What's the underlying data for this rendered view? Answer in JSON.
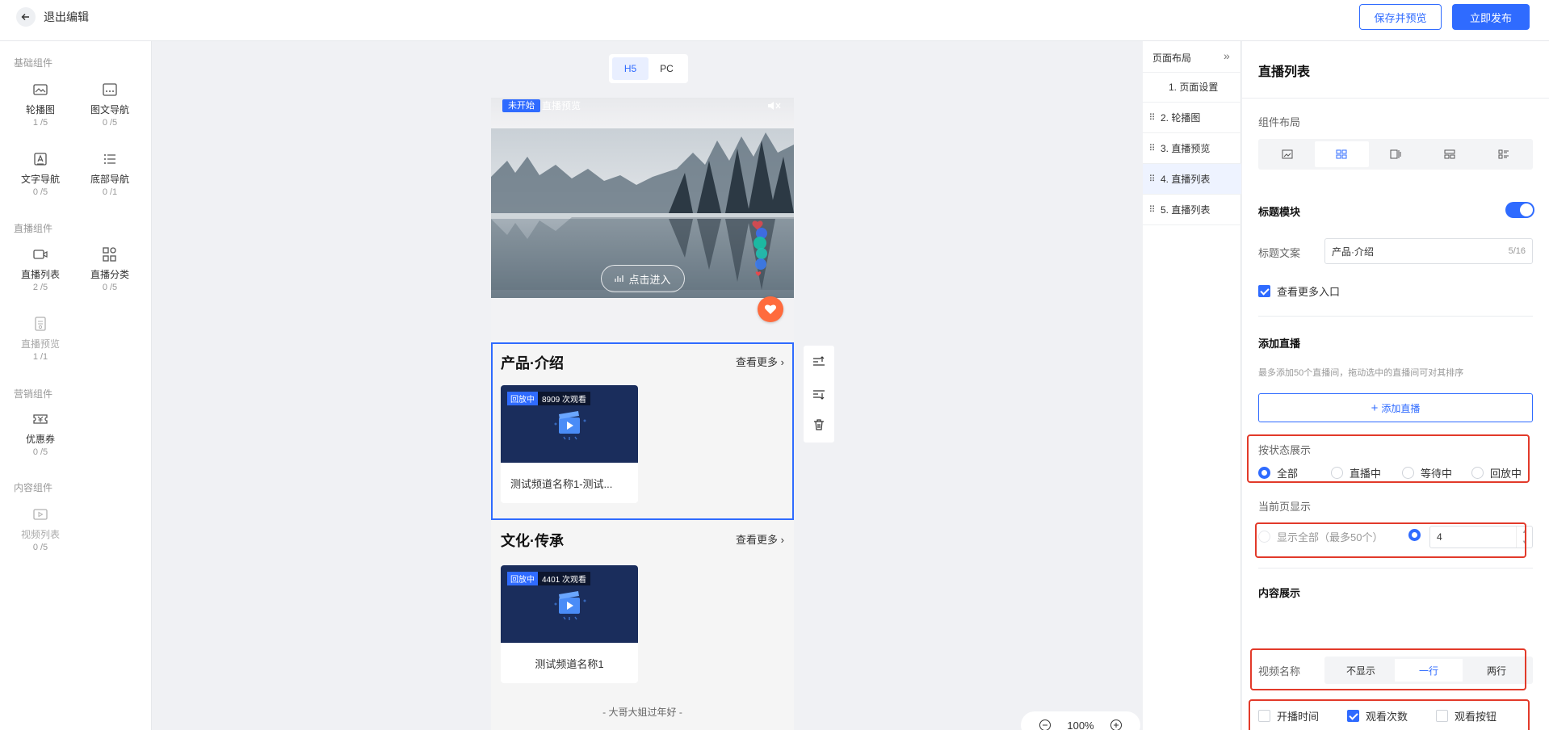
{
  "topbar": {
    "back_label": "退出编辑",
    "save_preview_label": "保存并预览",
    "publish_label": "立即发布"
  },
  "components": {
    "groups": [
      {
        "title": "基础组件",
        "items": [
          {
            "name": "轮播图",
            "count": "1 /5",
            "icon": "image-icon"
          },
          {
            "name": "图文导航",
            "count": "0 /5",
            "icon": "grid-nav-icon"
          },
          {
            "name": "文字导航",
            "count": "0 /5",
            "icon": "text-nav-icon"
          },
          {
            "name": "底部导航",
            "count": "0 /1",
            "icon": "list-icon"
          }
        ]
      },
      {
        "title": "直播组件",
        "items": [
          {
            "name": "直播列表",
            "count": "2 /5",
            "icon": "video-camera-icon"
          },
          {
            "name": "直播分类",
            "count": "0 /5",
            "icon": "category-icon"
          },
          {
            "name": "直播预览",
            "count": "1 /1",
            "icon": "preview-doc-icon"
          }
        ]
      },
      {
        "title": "营销组件",
        "items": [
          {
            "name": "优惠券",
            "count": "0 /5",
            "icon": "coupon-icon"
          }
        ]
      },
      {
        "title": "内容组件",
        "items": [
          {
            "name": "视频列表",
            "count": "0 /5",
            "icon": "video-list-icon"
          }
        ]
      }
    ]
  },
  "canvas": {
    "device_tabs": [
      "H5",
      "PC"
    ],
    "hero": {
      "status": "未开始",
      "title": "直播预览",
      "enter_label": "点击进入"
    },
    "sections": [
      {
        "title": "产品·介绍",
        "more": "查看更多",
        "cards": [
          {
            "status": "回放中",
            "views": "8909 次观看",
            "name": "测试频道名称1-测试..."
          }
        ]
      },
      {
        "title": "文化·传承",
        "more": "查看更多",
        "cards": [
          {
            "status": "回放中",
            "views": "4401 次观看",
            "name": "测试频道名称1"
          }
        ]
      }
    ],
    "footer": "- 大哥大姐过年好 -",
    "zoom": "100%"
  },
  "layout_panel": {
    "title": "页面布局",
    "items": [
      "1. 页面设置",
      "2. 轮播图",
      "3. 直播预览",
      "4. 直播列表",
      "5. 直播列表"
    ]
  },
  "settings": {
    "title": "直播列表",
    "layout_label": "组件布局",
    "title_module_label": "标题模块",
    "title_text_label": "标题文案",
    "title_text_value": "产品·介绍",
    "title_text_count": "5/16",
    "view_more_label": "查看更多入口",
    "add_live_label": "添加直播",
    "add_live_hint": "最多添加50个直播间，拖动选中的直播间可对其排序",
    "add_live_button": "添加直播",
    "status_label": "按状态展示",
    "status_options": [
      "全部",
      "直播中",
      "等待中",
      "回放中"
    ],
    "page_display_label": "当前页显示",
    "show_all_label": "显示全部（最多50个）",
    "page_count_value": "4",
    "content_label": "内容展示",
    "video_name_label": "视频名称",
    "video_name_options": [
      "不显示",
      "一行",
      "两行"
    ],
    "opt_start_time": "开播时间",
    "opt_view_count": "观看次数",
    "opt_view_button": "观看按钮"
  },
  "colors": {
    "accent": "#2f6bff",
    "highlight": "#e23a2a"
  }
}
